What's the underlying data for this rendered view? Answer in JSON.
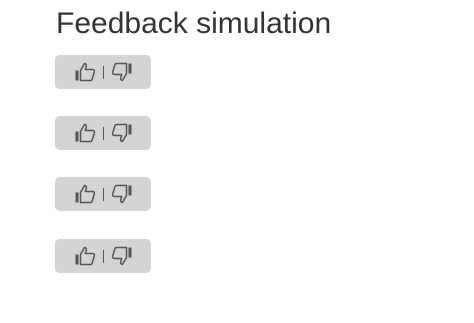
{
  "page": {
    "title": "Feedback simulation"
  },
  "feedback_widgets": [
    {
      "thumbs_up_icon": "thumbs-up-icon",
      "thumbs_down_icon": "thumbs-down-icon"
    },
    {
      "thumbs_up_icon": "thumbs-up-icon",
      "thumbs_down_icon": "thumbs-down-icon"
    },
    {
      "thumbs_up_icon": "thumbs-up-icon",
      "thumbs_down_icon": "thumbs-down-icon"
    },
    {
      "thumbs_up_icon": "thumbs-up-icon",
      "thumbs_down_icon": "thumbs-down-icon"
    }
  ],
  "colors": {
    "background": "#ffffff",
    "widget_background": "#d4d4d4",
    "icon": "#555555",
    "title_text": "#333333"
  }
}
